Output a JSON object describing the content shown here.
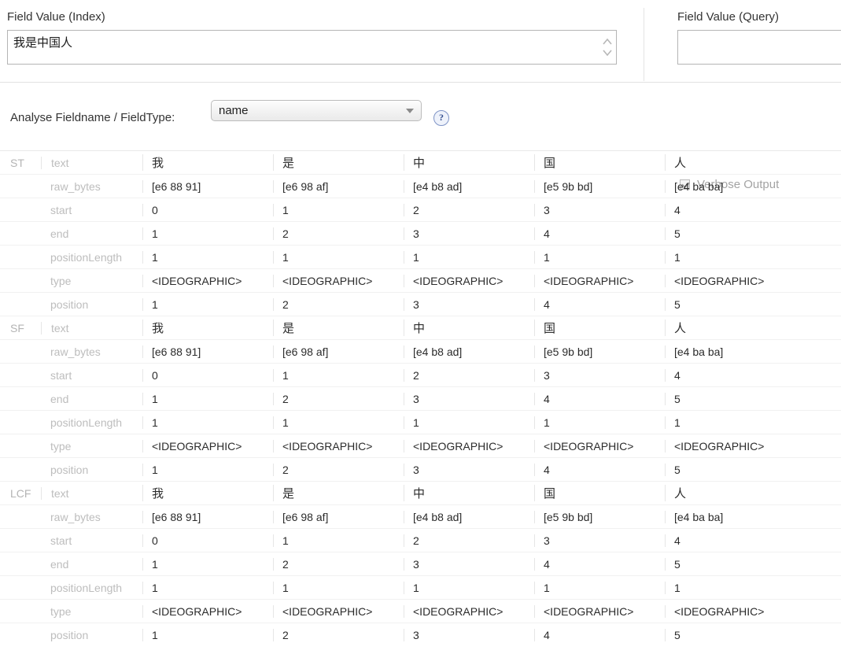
{
  "top": {
    "index_label": "Field Value (Index)",
    "index_value": "我是中国人",
    "query_label": "Field Value (Query)",
    "query_value": "",
    "resize_grip_icon": "updown-spinner-icon"
  },
  "controls": {
    "analyse_label": "Analyse Fieldname / FieldType:",
    "fieldtype_selected": "name",
    "help_icon": "question-mark-icon",
    "verbose_label": "Verbose Output",
    "verbose_checked": true
  },
  "table": {
    "attributes": [
      "text",
      "raw_bytes",
      "start",
      "end",
      "positionLength",
      "type",
      "position"
    ],
    "sections": [
      {
        "name": "ST",
        "tokens": [
          {
            "text": "我",
            "raw_bytes": "[e6 88 91]",
            "start": "0",
            "end": "1",
            "positionLength": "1",
            "type": "<IDEOGRAPHIC>",
            "position": "1"
          },
          {
            "text": "是",
            "raw_bytes": "[e6 98 af]",
            "start": "1",
            "end": "2",
            "positionLength": "1",
            "type": "<IDEOGRAPHIC>",
            "position": "2"
          },
          {
            "text": "中",
            "raw_bytes": "[e4 b8 ad]",
            "start": "2",
            "end": "3",
            "positionLength": "1",
            "type": "<IDEOGRAPHIC>",
            "position": "3"
          },
          {
            "text": "国",
            "raw_bytes": "[e5 9b bd]",
            "start": "3",
            "end": "4",
            "positionLength": "1",
            "type": "<IDEOGRAPHIC>",
            "position": "4"
          },
          {
            "text": "人",
            "raw_bytes": "[e4 ba ba]",
            "start": "4",
            "end": "5",
            "positionLength": "1",
            "type": "<IDEOGRAPHIC>",
            "position": "5"
          }
        ]
      },
      {
        "name": "SF",
        "tokens": [
          {
            "text": "我",
            "raw_bytes": "[e6 88 91]",
            "start": "0",
            "end": "1",
            "positionLength": "1",
            "type": "<IDEOGRAPHIC>",
            "position": "1"
          },
          {
            "text": "是",
            "raw_bytes": "[e6 98 af]",
            "start": "1",
            "end": "2",
            "positionLength": "1",
            "type": "<IDEOGRAPHIC>",
            "position": "2"
          },
          {
            "text": "中",
            "raw_bytes": "[e4 b8 ad]",
            "start": "2",
            "end": "3",
            "positionLength": "1",
            "type": "<IDEOGRAPHIC>",
            "position": "3"
          },
          {
            "text": "国",
            "raw_bytes": "[e5 9b bd]",
            "start": "3",
            "end": "4",
            "positionLength": "1",
            "type": "<IDEOGRAPHIC>",
            "position": "4"
          },
          {
            "text": "人",
            "raw_bytes": "[e4 ba ba]",
            "start": "4",
            "end": "5",
            "positionLength": "1",
            "type": "<IDEOGRAPHIC>",
            "position": "5"
          }
        ]
      },
      {
        "name": "LCF",
        "tokens": [
          {
            "text": "我",
            "raw_bytes": "[e6 88 91]",
            "start": "0",
            "end": "1",
            "positionLength": "1",
            "type": "<IDEOGRAPHIC>",
            "position": "1"
          },
          {
            "text": "是",
            "raw_bytes": "[e6 98 af]",
            "start": "1",
            "end": "2",
            "positionLength": "1",
            "type": "<IDEOGRAPHIC>",
            "position": "2"
          },
          {
            "text": "中",
            "raw_bytes": "[e4 b8 ad]",
            "start": "2",
            "end": "3",
            "positionLength": "1",
            "type": "<IDEOGRAPHIC>",
            "position": "3"
          },
          {
            "text": "国",
            "raw_bytes": "[e5 9b bd]",
            "start": "3",
            "end": "4",
            "positionLength": "1",
            "type": "<IDEOGRAPHIC>",
            "position": "4"
          },
          {
            "text": "人",
            "raw_bytes": "[e4 ba ba]",
            "start": "4",
            "end": "5",
            "positionLength": "1",
            "type": "<IDEOGRAPHIC>",
            "position": "5"
          }
        ]
      }
    ]
  },
  "colors": {
    "accent": "#36508f",
    "muted_text": "#bdbdbd",
    "value_text": "#2b2b2b",
    "border": "#e6e6e6"
  }
}
